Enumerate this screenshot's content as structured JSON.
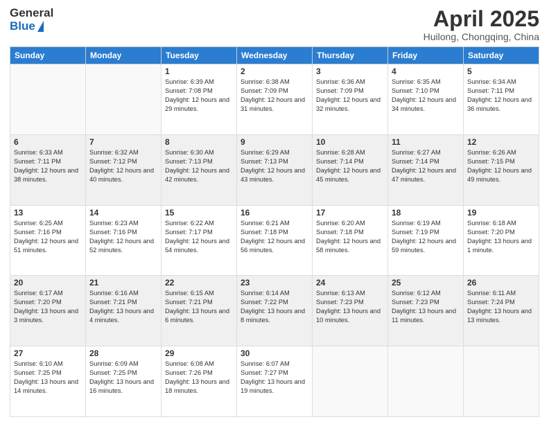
{
  "header": {
    "logo_general": "General",
    "logo_blue": "Blue",
    "title": "April 2025",
    "subtitle": "Huilong, Chongqing, China"
  },
  "weekdays": [
    "Sunday",
    "Monday",
    "Tuesday",
    "Wednesday",
    "Thursday",
    "Friday",
    "Saturday"
  ],
  "weeks": [
    [
      {
        "day": "",
        "info": ""
      },
      {
        "day": "",
        "info": ""
      },
      {
        "day": "1",
        "info": "Sunrise: 6:39 AM\nSunset: 7:08 PM\nDaylight: 12 hours and 29 minutes."
      },
      {
        "day": "2",
        "info": "Sunrise: 6:38 AM\nSunset: 7:09 PM\nDaylight: 12 hours and 31 minutes."
      },
      {
        "day": "3",
        "info": "Sunrise: 6:36 AM\nSunset: 7:09 PM\nDaylight: 12 hours and 32 minutes."
      },
      {
        "day": "4",
        "info": "Sunrise: 6:35 AM\nSunset: 7:10 PM\nDaylight: 12 hours and 34 minutes."
      },
      {
        "day": "5",
        "info": "Sunrise: 6:34 AM\nSunset: 7:11 PM\nDaylight: 12 hours and 36 minutes."
      }
    ],
    [
      {
        "day": "6",
        "info": "Sunrise: 6:33 AM\nSunset: 7:11 PM\nDaylight: 12 hours and 38 minutes."
      },
      {
        "day": "7",
        "info": "Sunrise: 6:32 AM\nSunset: 7:12 PM\nDaylight: 12 hours and 40 minutes."
      },
      {
        "day": "8",
        "info": "Sunrise: 6:30 AM\nSunset: 7:13 PM\nDaylight: 12 hours and 42 minutes."
      },
      {
        "day": "9",
        "info": "Sunrise: 6:29 AM\nSunset: 7:13 PM\nDaylight: 12 hours and 43 minutes."
      },
      {
        "day": "10",
        "info": "Sunrise: 6:28 AM\nSunset: 7:14 PM\nDaylight: 12 hours and 45 minutes."
      },
      {
        "day": "11",
        "info": "Sunrise: 6:27 AM\nSunset: 7:14 PM\nDaylight: 12 hours and 47 minutes."
      },
      {
        "day": "12",
        "info": "Sunrise: 6:26 AM\nSunset: 7:15 PM\nDaylight: 12 hours and 49 minutes."
      }
    ],
    [
      {
        "day": "13",
        "info": "Sunrise: 6:25 AM\nSunset: 7:16 PM\nDaylight: 12 hours and 51 minutes."
      },
      {
        "day": "14",
        "info": "Sunrise: 6:23 AM\nSunset: 7:16 PM\nDaylight: 12 hours and 52 minutes."
      },
      {
        "day": "15",
        "info": "Sunrise: 6:22 AM\nSunset: 7:17 PM\nDaylight: 12 hours and 54 minutes."
      },
      {
        "day": "16",
        "info": "Sunrise: 6:21 AM\nSunset: 7:18 PM\nDaylight: 12 hours and 56 minutes."
      },
      {
        "day": "17",
        "info": "Sunrise: 6:20 AM\nSunset: 7:18 PM\nDaylight: 12 hours and 58 minutes."
      },
      {
        "day": "18",
        "info": "Sunrise: 6:19 AM\nSunset: 7:19 PM\nDaylight: 12 hours and 59 minutes."
      },
      {
        "day": "19",
        "info": "Sunrise: 6:18 AM\nSunset: 7:20 PM\nDaylight: 13 hours and 1 minute."
      }
    ],
    [
      {
        "day": "20",
        "info": "Sunrise: 6:17 AM\nSunset: 7:20 PM\nDaylight: 13 hours and 3 minutes."
      },
      {
        "day": "21",
        "info": "Sunrise: 6:16 AM\nSunset: 7:21 PM\nDaylight: 13 hours and 4 minutes."
      },
      {
        "day": "22",
        "info": "Sunrise: 6:15 AM\nSunset: 7:21 PM\nDaylight: 13 hours and 6 minutes."
      },
      {
        "day": "23",
        "info": "Sunrise: 6:14 AM\nSunset: 7:22 PM\nDaylight: 13 hours and 8 minutes."
      },
      {
        "day": "24",
        "info": "Sunrise: 6:13 AM\nSunset: 7:23 PM\nDaylight: 13 hours and 10 minutes."
      },
      {
        "day": "25",
        "info": "Sunrise: 6:12 AM\nSunset: 7:23 PM\nDaylight: 13 hours and 11 minutes."
      },
      {
        "day": "26",
        "info": "Sunrise: 6:11 AM\nSunset: 7:24 PM\nDaylight: 13 hours and 13 minutes."
      }
    ],
    [
      {
        "day": "27",
        "info": "Sunrise: 6:10 AM\nSunset: 7:25 PM\nDaylight: 13 hours and 14 minutes."
      },
      {
        "day": "28",
        "info": "Sunrise: 6:09 AM\nSunset: 7:25 PM\nDaylight: 13 hours and 16 minutes."
      },
      {
        "day": "29",
        "info": "Sunrise: 6:08 AM\nSunset: 7:26 PM\nDaylight: 13 hours and 18 minutes."
      },
      {
        "day": "30",
        "info": "Sunrise: 6:07 AM\nSunset: 7:27 PM\nDaylight: 13 hours and 19 minutes."
      },
      {
        "day": "",
        "info": ""
      },
      {
        "day": "",
        "info": ""
      },
      {
        "day": "",
        "info": ""
      }
    ]
  ]
}
